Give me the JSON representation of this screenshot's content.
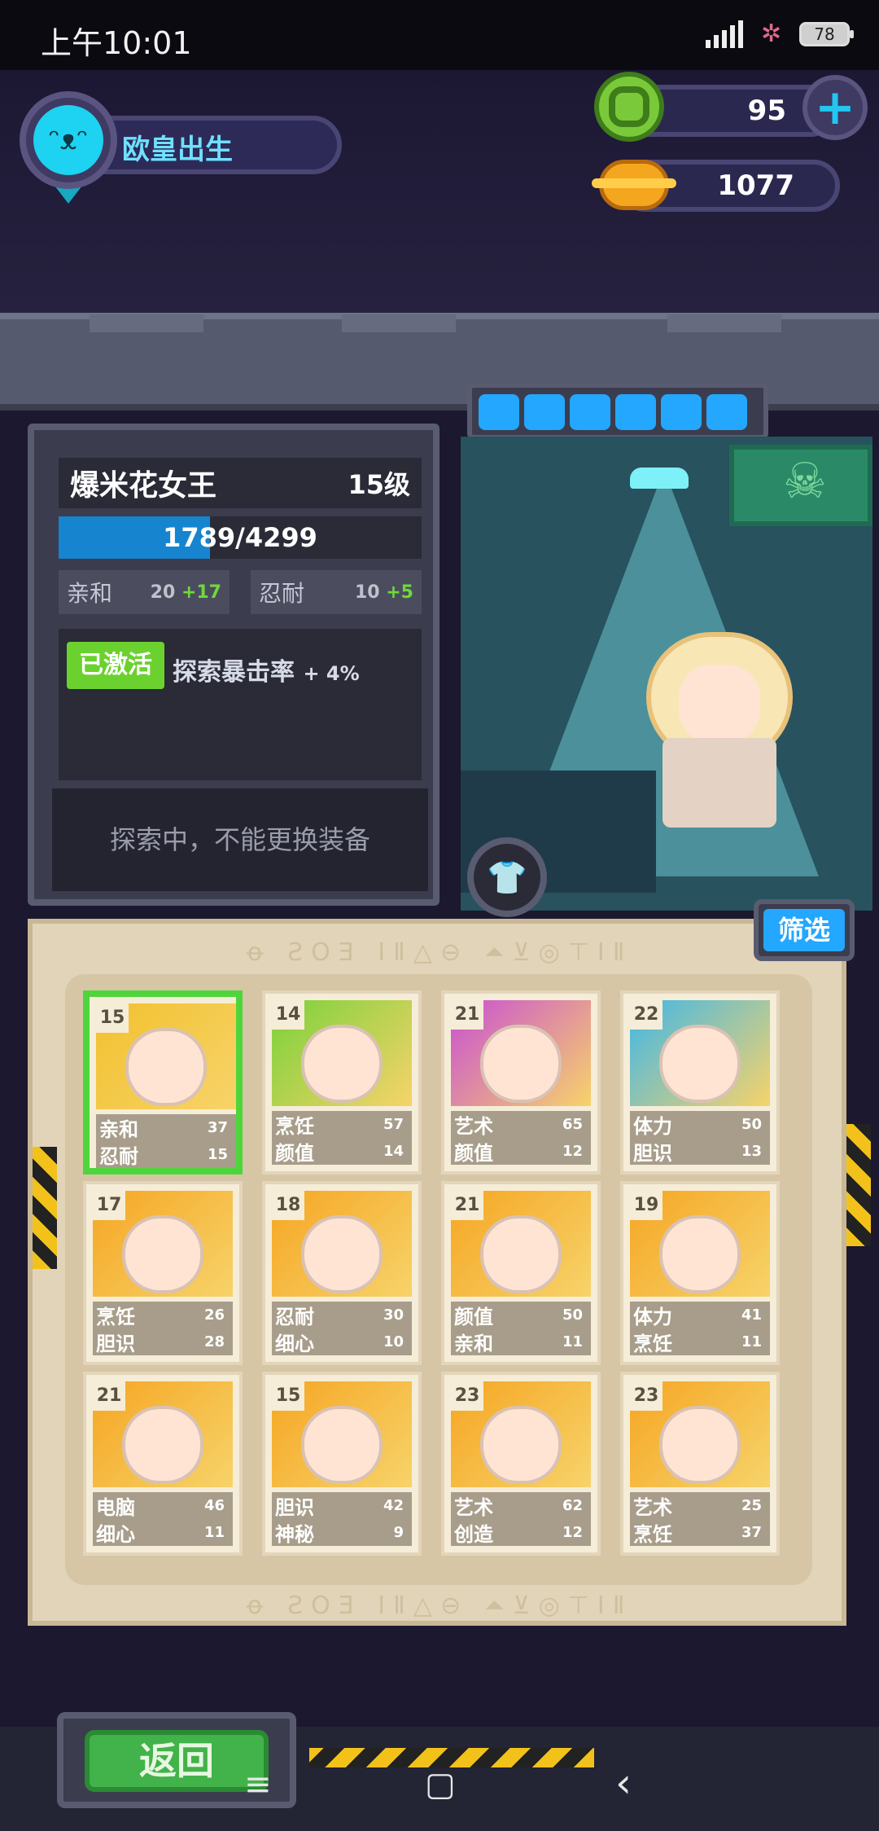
{
  "status_bar": {
    "time": "上午10:01",
    "battery": "78"
  },
  "profile": {
    "name": "欧皇出生"
  },
  "currencies": {
    "gems": "95",
    "coins": "1077"
  },
  "hero": {
    "name": "爆米花女王",
    "level": "15级",
    "exp_current": 1789,
    "exp_max": 4299,
    "exp_text": "1789/4299",
    "stats": [
      {
        "label": "亲和",
        "value": "20",
        "bonus": "+17"
      },
      {
        "label": "忍耐",
        "value": "10",
        "bonus": "+5"
      }
    ],
    "skill": {
      "tag": "已激活",
      "text": "探索暴击率",
      "pct": "+ 4%"
    },
    "locked_message": "探索中，不能更换装备"
  },
  "filter_button": "筛选",
  "back_button": "返回",
  "cards": [
    {
      "level": "15",
      "stats": [
        [
          "亲和",
          "37"
        ],
        [
          "忍耐",
          "15"
        ]
      ],
      "color": "#f2c12e",
      "selected": true
    },
    {
      "level": "14",
      "stats": [
        [
          "烹饪",
          "57"
        ],
        [
          "颜值",
          "14"
        ]
      ],
      "color": "#7ad13a"
    },
    {
      "level": "21",
      "stats": [
        [
          "艺术",
          "65"
        ],
        [
          "颜值",
          "12"
        ]
      ],
      "color": "#c94fd3"
    },
    {
      "level": "22",
      "stats": [
        [
          "体力",
          "50"
        ],
        [
          "胆识",
          "13"
        ]
      ],
      "color": "#3fb7e8"
    },
    {
      "level": "17",
      "stats": [
        [
          "烹饪",
          "26"
        ],
        [
          "胆识",
          "28"
        ]
      ],
      "color": "#f5a623"
    },
    {
      "level": "18",
      "stats": [
        [
          "忍耐",
          "30"
        ],
        [
          "细心",
          "10"
        ]
      ],
      "color": "#f5a623"
    },
    {
      "level": "21",
      "stats": [
        [
          "颜值",
          "50"
        ],
        [
          "亲和",
          "11"
        ]
      ],
      "color": "#f5a623"
    },
    {
      "level": "19",
      "stats": [
        [
          "体力",
          "41"
        ],
        [
          "烹饪",
          "11"
        ]
      ],
      "color": "#f5a623"
    },
    {
      "level": "21",
      "stats": [
        [
          "电脑",
          "46"
        ],
        [
          "细心",
          "11"
        ]
      ],
      "color": "#f5a623"
    },
    {
      "level": "15",
      "stats": [
        [
          "胆识",
          "42"
        ],
        [
          "神秘",
          "9"
        ]
      ],
      "color": "#f5a623"
    },
    {
      "level": "23",
      "stats": [
        [
          "艺术",
          "62"
        ],
        [
          "创造",
          "12"
        ]
      ],
      "color": "#f5a623"
    },
    {
      "level": "23",
      "stats": [
        [
          "艺术",
          "25"
        ],
        [
          "烹饪",
          "37"
        ]
      ],
      "color": "#f5a623"
    }
  ],
  "nav": {
    "menu": "≡",
    "home": "▢",
    "back": "‹"
  }
}
